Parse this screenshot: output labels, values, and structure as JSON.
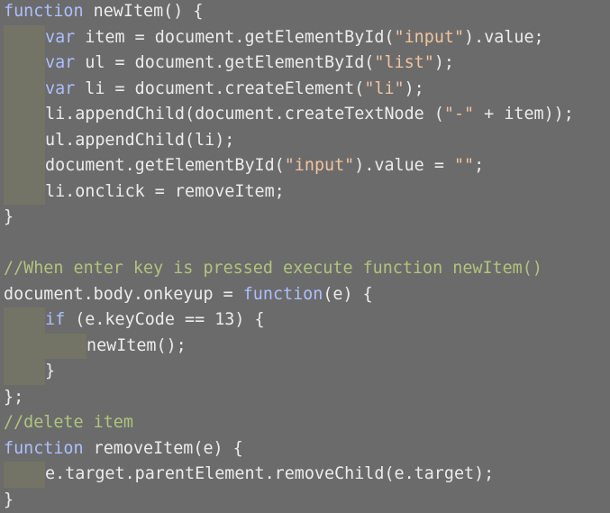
{
  "editor": {
    "lines": [
      {
        "indent": 0,
        "tokens": [
          {
            "t": "function",
            "c": "kw"
          },
          {
            "t": " newItem() {",
            "c": "pl"
          }
        ]
      },
      {
        "indent": 1,
        "tokens": [
          {
            "t": "var",
            "c": "kw"
          },
          {
            "t": " item = document.getElementById(",
            "c": "pl"
          },
          {
            "t": "\"input\"",
            "c": "str"
          },
          {
            "t": ").value;",
            "c": "pl"
          }
        ]
      },
      {
        "indent": 1,
        "tokens": [
          {
            "t": "var",
            "c": "kw"
          },
          {
            "t": " ul = document.getElementById(",
            "c": "pl"
          },
          {
            "t": "\"list\"",
            "c": "str"
          },
          {
            "t": ");",
            "c": "pl"
          }
        ]
      },
      {
        "indent": 1,
        "tokens": [
          {
            "t": "var",
            "c": "kw"
          },
          {
            "t": " li = document.createElement(",
            "c": "pl"
          },
          {
            "t": "\"li\"",
            "c": "str"
          },
          {
            "t": ");",
            "c": "pl"
          }
        ]
      },
      {
        "indent": 1,
        "tokens": [
          {
            "t": "li.appendChild(document.createTextNode (",
            "c": "pl"
          },
          {
            "t": "\"-\"",
            "c": "str"
          },
          {
            "t": " + item));",
            "c": "pl"
          }
        ]
      },
      {
        "indent": 1,
        "tokens": [
          {
            "t": "ul.appendChild(li);",
            "c": "pl"
          }
        ]
      },
      {
        "indent": 1,
        "tokens": [
          {
            "t": "document.getElementById(",
            "c": "pl"
          },
          {
            "t": "\"input\"",
            "c": "str"
          },
          {
            "t": ").value = ",
            "c": "pl"
          },
          {
            "t": "\"\"",
            "c": "str"
          },
          {
            "t": ";",
            "c": "pl"
          }
        ]
      },
      {
        "indent": 1,
        "tokens": [
          {
            "t": "li.onclick = removeItem;",
            "c": "pl"
          }
        ]
      },
      {
        "indent": 0,
        "tokens": [
          {
            "t": "}",
            "c": "pl"
          }
        ]
      },
      {
        "indent": 0,
        "tokens": []
      },
      {
        "indent": 0,
        "tokens": [
          {
            "t": "//When enter key is pressed execute function newItem()",
            "c": "cm"
          }
        ]
      },
      {
        "indent": 0,
        "tokens": [
          {
            "t": "document.body.onkeyup = ",
            "c": "pl"
          },
          {
            "t": "function",
            "c": "kw"
          },
          {
            "t": "(e) {",
            "c": "pl"
          }
        ]
      },
      {
        "indent": 1,
        "tokens": [
          {
            "t": "if",
            "c": "kw"
          },
          {
            "t": " (e.keyCode == 13) {",
            "c": "pl"
          }
        ]
      },
      {
        "indent": 2,
        "tokens": [
          {
            "t": "newItem();",
            "c": "pl"
          }
        ]
      },
      {
        "indent": 1,
        "tokens": [
          {
            "t": "}",
            "c": "pl"
          }
        ]
      },
      {
        "indent": 0,
        "tokens": [
          {
            "t": "};",
            "c": "pl"
          }
        ]
      },
      {
        "indent": 0,
        "tokens": [
          {
            "t": "//delete item",
            "c": "cm"
          }
        ]
      },
      {
        "indent": 0,
        "tokens": [
          {
            "t": "function",
            "c": "kw"
          },
          {
            "t": " removeItem(e) {",
            "c": "pl"
          }
        ]
      },
      {
        "indent": 1,
        "tokens": [
          {
            "t": "e.target.parentElement.removeChild(e.target);",
            "c": "pl"
          }
        ]
      },
      {
        "indent": 0,
        "tokens": [
          {
            "t": "}",
            "c": "pl"
          }
        ]
      }
    ]
  },
  "colors": {
    "background": "#6b6b6b",
    "keyword": "#aebfff",
    "string": "#f0c4a0",
    "comment": "#b0c47e",
    "plain": "#ececec",
    "indent_guide": "#747466"
  }
}
